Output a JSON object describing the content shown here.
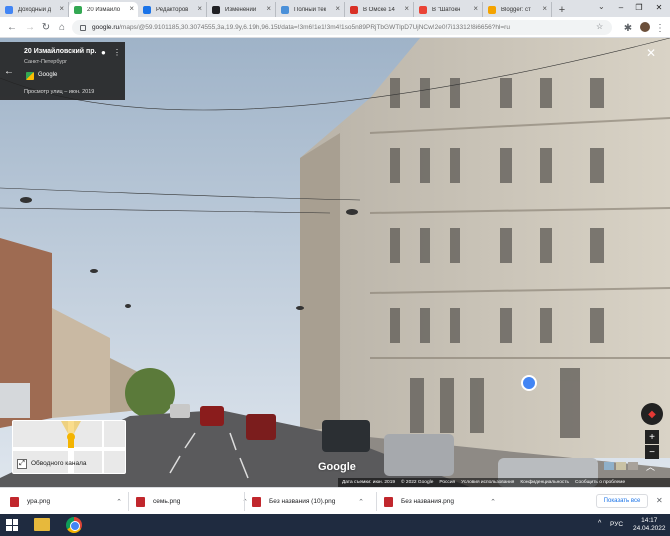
{
  "browser": {
    "tabs": [
      {
        "label": "Доходный д",
        "fav_color": "#4285f4",
        "active": false
      },
      {
        "label": "20 Измайло",
        "fav_color": "#34a853",
        "active": true
      },
      {
        "label": "Редакторов",
        "fav_color": "#1a73e8",
        "active": false
      },
      {
        "label": "Изменений",
        "fav_color": "#202124",
        "active": false
      },
      {
        "label": "Полный тек",
        "fav_color": "#4a90d9",
        "active": false
      },
      {
        "label": "В Омске 14",
        "fav_color": "#d93025",
        "active": false
      },
      {
        "label": "В \"Шатокн",
        "fav_color": "#ea4335",
        "active": false
      },
      {
        "label": "Blogger: ст",
        "fav_color": "#f4a300",
        "active": false
      }
    ],
    "new_tab": "+",
    "address": {
      "host": "google.ru",
      "path": "/maps/@59.9101185,30.3074555,3a,19.9y,6.19h,96.15t/data=!3m6!1e1!3m4!1so5n89PRjTbGWTlpD7UjNCw!2e0!7i13312!8i6656?hl=ru"
    }
  },
  "infocard": {
    "title": "20 Измайловский пр.",
    "city": "Санкт-Петербург",
    "provider": "Google",
    "date": "Просмотр улиц – июн. 2019"
  },
  "minimap": {
    "label": "Обводного канала"
  },
  "watermark": "Google",
  "footer": [
    "Дата съемки: июн. 2019",
    "© 2022 Google",
    "Россия",
    "Условия использования",
    "Конфиденциальность",
    "Сообщить о проблеме"
  ],
  "downloads": [
    {
      "name": "ура.png"
    },
    {
      "name": "семь.png"
    },
    {
      "name": "Без названия (10).png"
    },
    {
      "name": "Без названия.png"
    }
  ],
  "show_all": "Показать все",
  "taskbar": {
    "lang": "РУС",
    "time": "14:17",
    "date": "24.04.2022"
  }
}
